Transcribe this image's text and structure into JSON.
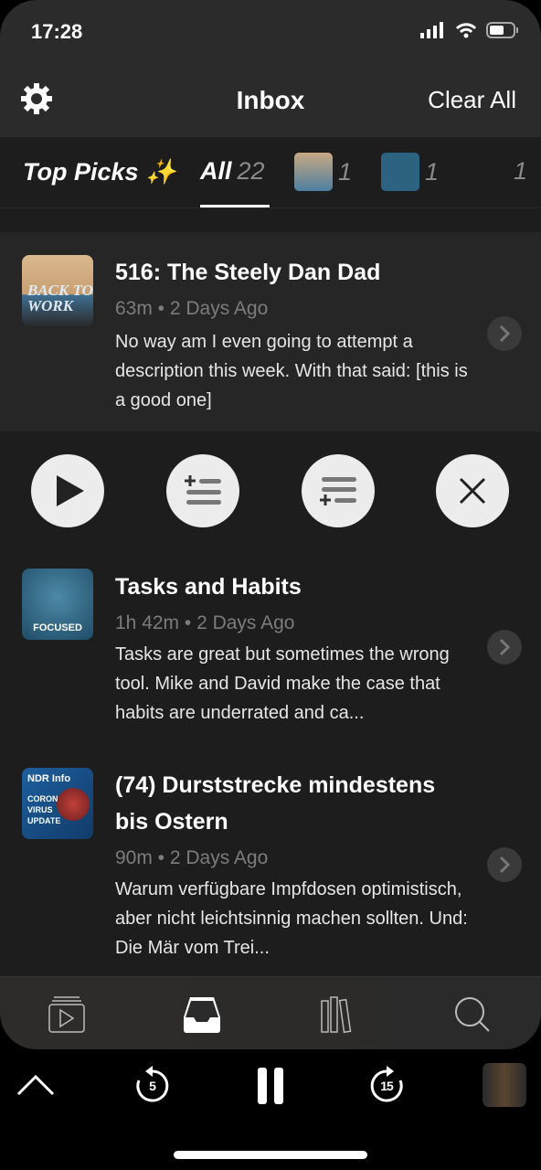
{
  "status": {
    "time": "17:28"
  },
  "header": {
    "title": "Inbox",
    "clear_all": "Clear All"
  },
  "tabs": [
    {
      "label": "Top Picks ✨"
    },
    {
      "label": "All",
      "count": "22",
      "active": true
    },
    {
      "label": "Back to Work",
      "count": "1"
    },
    {
      "label": "Focused",
      "count": "1"
    },
    {
      "label": "",
      "count": "1"
    }
  ],
  "episodes": [
    {
      "podcast": "Back to Work",
      "title": "516: The Steely Dan Dad",
      "meta": "63m • 2 Days Ago",
      "desc": "No way am I even going to attempt a description this week. With that said: [this is a good one]"
    },
    {
      "podcast": "Focused",
      "title": "Tasks and Habits",
      "meta": "1h 42m • 2 Days Ago",
      "desc": "Tasks are great but sometimes the wrong tool. Mike and David make the case that habits are underrated and ca..."
    },
    {
      "podcast": "NDR Info Corona Virus Update",
      "title": "(74) Durststrecke mindestens bis Ostern",
      "meta": "90m • 2 Days Ago",
      "desc": "Warum verfügbare Impfdosen optimistisch, aber nicht leichtsinnig machen sollten. Und: Die Mär vom Trei..."
    }
  ],
  "art_text": {
    "btw": "BACK TO WORK",
    "focused": "FOCUSED",
    "ndr": "NDR Info",
    "corona": "CORONA VIRUS UPDATE"
  },
  "player": {
    "skip_back": "5",
    "skip_forward": "15"
  },
  "colors": {
    "background": "#1d1d1d",
    "header": "#2b2b2b",
    "accent": "#ffffff"
  }
}
